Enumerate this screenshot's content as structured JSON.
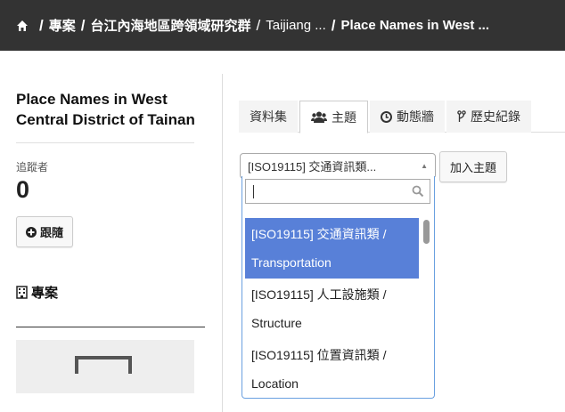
{
  "breadcrumb": {
    "items": [
      "專案",
      "台江內海地區跨領域研究群",
      "Taijiang ...",
      "Place Names in West ..."
    ],
    "separator": "/"
  },
  "sidebar": {
    "title": "Place Names in West Central District of Tainan",
    "followers_label": "追蹤者",
    "followers_count": "0",
    "follow_button": "跟隨",
    "project_heading": "專案"
  },
  "tabs": [
    {
      "label": "資料集",
      "icon": ""
    },
    {
      "label": "主題",
      "icon": "users-icon"
    },
    {
      "label": "動態牆",
      "icon": "clock-icon"
    },
    {
      "label": "歷史紀錄",
      "icon": "branch-icon"
    }
  ],
  "topic_select": {
    "value": "[ISO19115] 交通資訊類...",
    "add_button": "加入主題",
    "search_value": "",
    "options": [
      {
        "line1": "[ISO19115] 交通資訊類 /",
        "line2": "Transportation",
        "highlighted": true
      },
      {
        "line1": "[ISO19115] 人工設施類 /",
        "line2": "Structure",
        "highlighted": false
      },
      {
        "line1": "[ISO19115] 位置資訊類 /",
        "line2": "Location",
        "highlighted": false
      }
    ]
  },
  "colors": {
    "topbar": "#333333",
    "highlight": "#5880d8",
    "focus_border": "#6aa0e0"
  }
}
